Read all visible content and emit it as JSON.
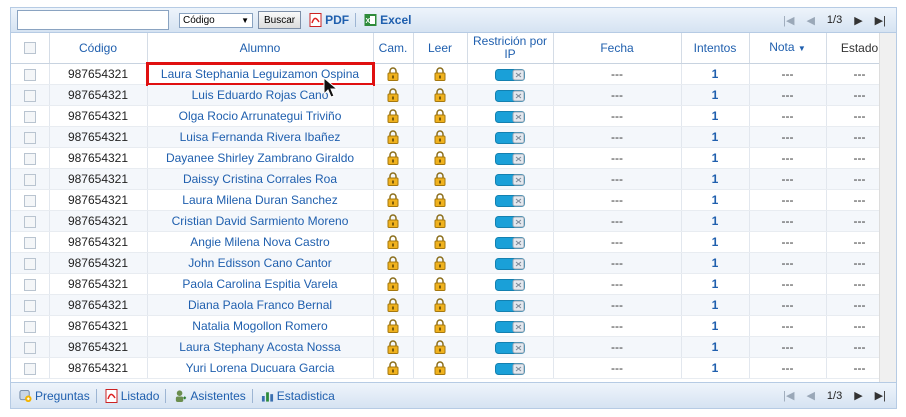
{
  "toolbar": {
    "search_value": "",
    "select_value": "Código",
    "search_button": "Buscar",
    "pdf_label": "PDF",
    "excel_label": "Excel"
  },
  "pager_top": {
    "text": "1/3"
  },
  "pager_bottom": {
    "text": "1/3"
  },
  "columns": {
    "codigo": "Código",
    "alumno": "Alumno",
    "cam": "Cam.",
    "leer": "Leer",
    "restriccion": "Restrición por IP",
    "fecha": "Fecha",
    "intentos": "Intentos",
    "nota": "Nota",
    "estado": "Estado"
  },
  "rows": [
    {
      "codigo": "987654321",
      "alumno": "Laura Stephania Leguizamon Ospina",
      "fecha": "---",
      "intentos": "1",
      "nota": "---",
      "estado": "---"
    },
    {
      "codigo": "987654321",
      "alumno": "Luis Eduardo Rojas Cano",
      "fecha": "---",
      "intentos": "1",
      "nota": "---",
      "estado": "---"
    },
    {
      "codigo": "987654321",
      "alumno": "Olga Rocio Arrunategui Triviño",
      "fecha": "---",
      "intentos": "1",
      "nota": "---",
      "estado": "---"
    },
    {
      "codigo": "987654321",
      "alumno": "Luisa Fernanda Rivera Ibañez",
      "fecha": "---",
      "intentos": "1",
      "nota": "---",
      "estado": "---"
    },
    {
      "codigo": "987654321",
      "alumno": "Dayanee Shirley Zambrano Giraldo",
      "fecha": "---",
      "intentos": "1",
      "nota": "---",
      "estado": "---"
    },
    {
      "codigo": "987654321",
      "alumno": "Daissy Cristina Corrales Roa",
      "fecha": "---",
      "intentos": "1",
      "nota": "---",
      "estado": "---"
    },
    {
      "codigo": "987654321",
      "alumno": "Laura Milena Duran Sanchez",
      "fecha": "---",
      "intentos": "1",
      "nota": "---",
      "estado": "---"
    },
    {
      "codigo": "987654321",
      "alumno": "Cristian David Sarmiento Moreno",
      "fecha": "---",
      "intentos": "1",
      "nota": "---",
      "estado": "---"
    },
    {
      "codigo": "987654321",
      "alumno": "Angie Milena Nova Castro",
      "fecha": "---",
      "intentos": "1",
      "nota": "---",
      "estado": "---"
    },
    {
      "codigo": "987654321",
      "alumno": "John Edisson Cano Cantor",
      "fecha": "---",
      "intentos": "1",
      "nota": "---",
      "estado": "---"
    },
    {
      "codigo": "987654321",
      "alumno": "Paola Carolina Espitia Varela",
      "fecha": "---",
      "intentos": "1",
      "nota": "---",
      "estado": "---"
    },
    {
      "codigo": "987654321",
      "alumno": "Diana Paola Franco Bernal",
      "fecha": "---",
      "intentos": "1",
      "nota": "---",
      "estado": "---"
    },
    {
      "codigo": "987654321",
      "alumno": "Natalia Mogollon Romero",
      "fecha": "---",
      "intentos": "1",
      "nota": "---",
      "estado": "---"
    },
    {
      "codigo": "987654321",
      "alumno": "Laura Stephany Acosta Nossa",
      "fecha": "---",
      "intentos": "1",
      "nota": "---",
      "estado": "---"
    },
    {
      "codigo": "987654321",
      "alumno": "Yuri Lorena Ducuara Garcia",
      "fecha": "---",
      "intentos": "1",
      "nota": "---",
      "estado": "---"
    }
  ],
  "bottom_toolbar": {
    "preguntas": "Preguntas",
    "listado": "Listado",
    "asistentes": "Asistentes",
    "estadistica": "Estadistica"
  },
  "icons": {
    "pdf": "pdf-icon",
    "excel": "excel-icon",
    "lock": "lock-icon",
    "toggle": "ip-toggle-icon",
    "preguntas": "questions-icon",
    "listado": "list-pdf-icon",
    "asistentes": "attendees-icon",
    "estadistica": "statistics-icon"
  },
  "colors": {
    "link": "#1f5fae",
    "highlight": "#e01010",
    "toggle": "#1aa0d8",
    "lock": "#e8a91a"
  }
}
